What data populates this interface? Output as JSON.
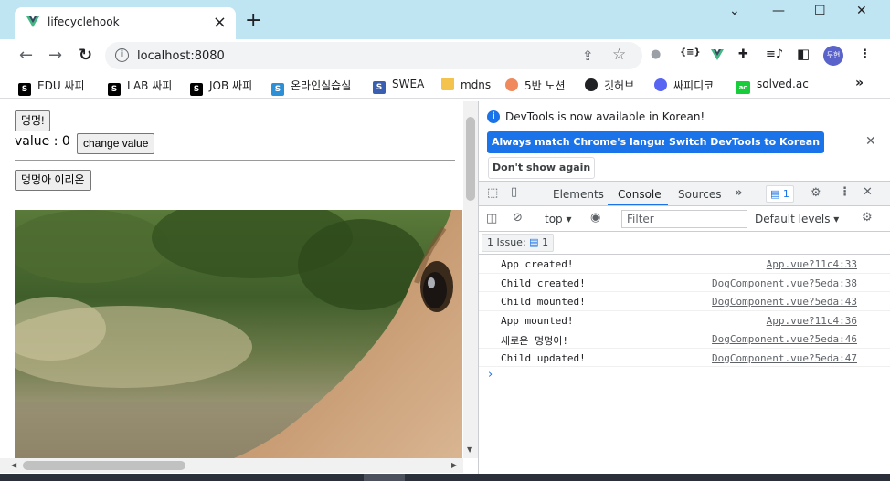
{
  "tab": {
    "title": "lifecyclehook",
    "favicon": "vue-icon"
  },
  "window": {
    "minimize": "—",
    "maximize": "☐",
    "close": "✕",
    "dropdown": "⌄"
  },
  "toolbar": {
    "url": "localhost:8080",
    "profile_label": "두현"
  },
  "bookmarks": [
    {
      "label": "EDU 싸피",
      "icon": "ssafy-icon",
      "color": "#000000"
    },
    {
      "label": "LAB 싸피",
      "icon": "ssafy-icon",
      "color": "#000000"
    },
    {
      "label": "JOB 싸피",
      "icon": "ssafy-icon",
      "color": "#000000"
    },
    {
      "label": "온라인실습실",
      "icon": "ssafy-icon",
      "color": "#2d8fd6"
    },
    {
      "label": "SWEA",
      "icon": "swea-icon",
      "color": "#3a5fb0"
    },
    {
      "label": "mdns",
      "icon": "folder-icon",
      "color": "#f4c34d"
    },
    {
      "label": "5반 노션",
      "icon": "peach-icon",
      "color": "#f08a5d"
    },
    {
      "label": "깃허브",
      "icon": "github-icon",
      "color": "#202124"
    },
    {
      "label": "싸피디코",
      "icon": "discord-icon",
      "color": "#5865f2"
    },
    {
      "label": "solved.ac",
      "icon": "solvedac-icon",
      "color": "#17ce3a"
    }
  ],
  "page": {
    "bark_button": "멍멍!",
    "value_text": "value : 0",
    "change_button": "change value",
    "rename_button": "멍멍아 이리온"
  },
  "devtools": {
    "info_message": "DevTools is now available in Korean!",
    "btn_match": "Always match Chrome's language",
    "btn_switch": "Switch DevTools to Korean",
    "btn_dont_show": "Don't show again",
    "tabs": [
      "Elements",
      "Console",
      "Sources"
    ],
    "active_tab": "Console",
    "issues_count": "1",
    "context": "top",
    "filter_placeholder": "Filter",
    "levels": "Default levels",
    "issue_chip_label": "1 Issue:",
    "issue_chip_count": "1",
    "logs": [
      {
        "msg": "App created!",
        "src": "App.vue?11c4:33"
      },
      {
        "msg": "Child created!",
        "src": "DogComponent.vue?5eda:38"
      },
      {
        "msg": "Child mounted!",
        "src": "DogComponent.vue?5eda:43"
      },
      {
        "msg": "App mounted!",
        "src": "App.vue?11c4:36"
      },
      {
        "msg": "새로운 멍멍이!",
        "src": "DogComponent.vue?5eda:46"
      },
      {
        "msg": "Child updated!",
        "src": "DogComponent.vue?5eda:47"
      }
    ]
  },
  "colors": {
    "accent": "#1a73e8",
    "tabstrip": "#bfe4f2"
  }
}
